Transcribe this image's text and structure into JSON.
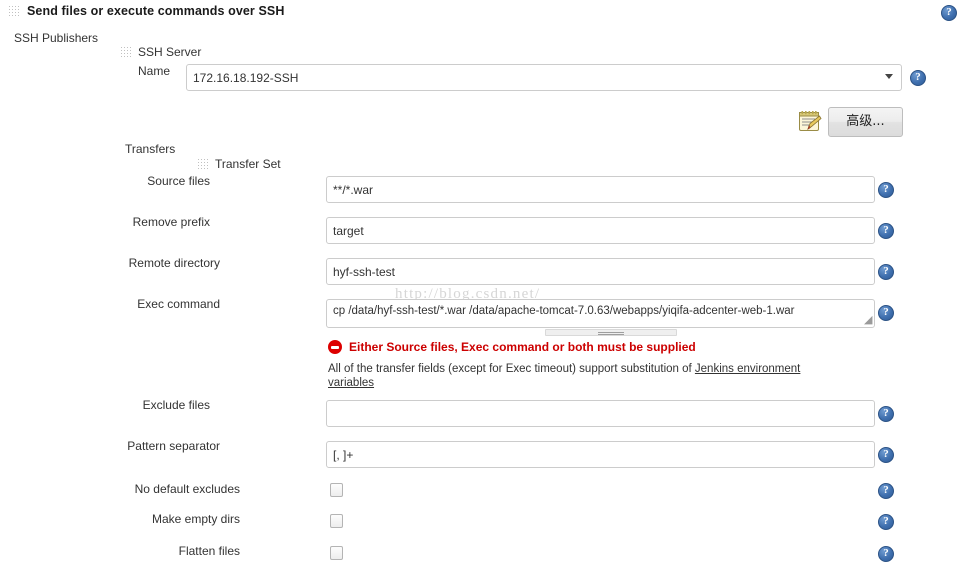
{
  "header": {
    "title": "Send files or execute commands over SSH",
    "grip_icon": "drag-grip-icon",
    "help_icon": "help-icon"
  },
  "publishers": {
    "label": "SSH Publishers"
  },
  "ssh_server": {
    "title": "SSH Server",
    "name_label": "Name",
    "name_value": "172.16.18.192-SSH",
    "options": [
      "172.16.18.192-SSH"
    ],
    "advanced_button": "高级...",
    "notepad_icon": "notepad-pencil-icon"
  },
  "transfers": {
    "label": "Transfers",
    "transfer_set_title": "Transfer Set",
    "fields": [
      {
        "label": "Source files",
        "value": "**/*.war"
      },
      {
        "label": "Remove prefix",
        "value": "target"
      },
      {
        "label": "Remote directory",
        "value": "hyf-ssh-test"
      }
    ],
    "exec_command": {
      "label": "Exec command",
      "value": "cp /data/hyf-ssh-test/*.war /data/apache-tomcat-7.0.63/webapps/yiqifa-adcenter-web-1.war"
    },
    "validation": {
      "message": "Either Source files, Exec command or both must be supplied",
      "icon": "error-icon"
    },
    "hint": {
      "text_before": "All of the transfer fields (except for Exec timeout) support substitution of ",
      "link_text": "Jenkins environment variables"
    },
    "fields_lower": [
      {
        "label": "Exclude files",
        "value": ""
      },
      {
        "label": "Pattern separator",
        "value": "[, ]+"
      }
    ],
    "checkboxes": [
      {
        "label": "No default excludes",
        "checked": false
      },
      {
        "label": "Make empty dirs",
        "checked": false
      },
      {
        "label": "Flatten files",
        "checked": false
      }
    ]
  },
  "watermark": "http://blog.csdn.net/",
  "colors": {
    "error_red": "#cc0000",
    "help_blue": "#3f6fae",
    "border_gray": "#cccccc"
  }
}
